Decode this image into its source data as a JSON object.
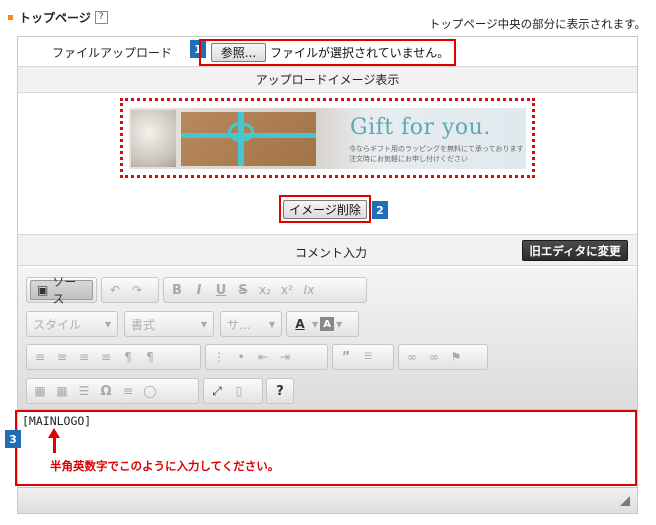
{
  "section": {
    "title": "トップページ",
    "help": "?",
    "note": "トップページ中央の部分に表示されます。"
  },
  "file_upload": {
    "label": "ファイルアップロード",
    "browse_label": "参照...",
    "status": "ファイルが選択されていません。",
    "badge": "1"
  },
  "upload_image": {
    "header": "アップロードイメージ表示",
    "banner_title": "Gift for you.",
    "banner_sub1": "今ならギフト用のラッピングを無料にて承っております",
    "banner_sub2": "注文時にお気軽にお申し付けください",
    "delete_label": "イメージ削除",
    "badge": "2"
  },
  "comment": {
    "label": "コメント入力",
    "old_editor_label": "旧エディタに変更"
  },
  "toolbar": {
    "source_label": "ソース",
    "style_label": "スタイル",
    "format_label": "書式",
    "size_label": "サ...",
    "bold": "B",
    "italic": "I",
    "underline": "U",
    "strike": "S",
    "subscript": "x₂",
    "superscript": "x²",
    "remove_format": "Ix",
    "text_color": "A",
    "bg_color": "A",
    "help": "?"
  },
  "editor": {
    "content": "[MAINLOGO]",
    "hint": "半角英数字でこのように入力してください。",
    "badge": "3"
  },
  "colors": {
    "accent_red": "#e00000",
    "badge_blue": "#1f6fb8",
    "title_orange": "#f28c1c",
    "banner_teal": "#5aa9b4"
  }
}
